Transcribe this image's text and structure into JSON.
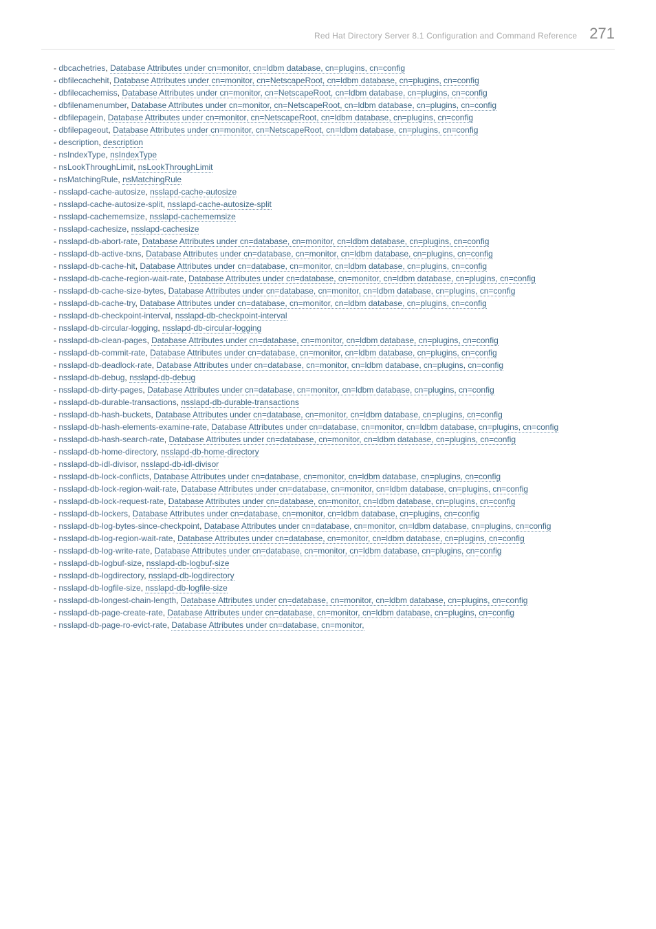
{
  "header": {
    "title": "Red Hat Directory Server 8.1 Configuration and Command Reference",
    "page_number": "271"
  },
  "items": [
    {
      "label": "dbcachetries",
      "link": "Database Attributes under cn=monitor, cn=ldbm database, cn=plugins, cn=config"
    },
    {
      "label": "dbfilecachehit",
      "link": "Database Attributes under cn=monitor, cn=NetscapeRoot, cn=ldbm database, cn=plugins, cn=config"
    },
    {
      "label": "dbfilecachemiss",
      "link": "Database Attributes under cn=monitor, cn=NetscapeRoot, cn=ldbm database, cn=plugins, cn=config"
    },
    {
      "label": "dbfilenamenumber",
      "link": "Database Attributes under cn=monitor, cn=NetscapeRoot, cn=ldbm database, cn=plugins, cn=config"
    },
    {
      "label": "dbfilepagein",
      "link": "Database Attributes under cn=monitor, cn=NetscapeRoot, cn=ldbm database, cn=plugins, cn=config"
    },
    {
      "label": "dbfilepageout",
      "link": "Database Attributes under cn=monitor, cn=NetscapeRoot, cn=ldbm database, cn=plugins, cn=config"
    },
    {
      "label": "description",
      "link": "description"
    },
    {
      "label": "nsIndexType",
      "link": "nsIndexType"
    },
    {
      "label": "nsLookThroughLimit",
      "link": "nsLookThroughLimit"
    },
    {
      "label": "nsMatchingRule",
      "link": "nsMatchingRule"
    },
    {
      "label": "nsslapd-cache-autosize",
      "link": "nsslapd-cache-autosize"
    },
    {
      "label": "nsslapd-cache-autosize-split",
      "link": "nsslapd-cache-autosize-split"
    },
    {
      "label": "nsslapd-cachememsize",
      "link": "nsslapd-cachememsize"
    },
    {
      "label": "nsslapd-cachesize",
      "link": "nsslapd-cachesize"
    },
    {
      "label": "nsslapd-db-abort-rate",
      "link": "Database Attributes under cn=database, cn=monitor, cn=ldbm database, cn=plugins, cn=config"
    },
    {
      "label": "nsslapd-db-active-txns",
      "link": "Database Attributes under cn=database, cn=monitor, cn=ldbm database, cn=plugins, cn=config"
    },
    {
      "label": "nsslapd-db-cache-hit",
      "link": "Database Attributes under cn=database, cn=monitor, cn=ldbm database, cn=plugins, cn=config"
    },
    {
      "label": "nsslapd-db-cache-region-wait-rate",
      "link": "Database Attributes under cn=database, cn=monitor, cn=ldbm database, cn=plugins, cn=config"
    },
    {
      "label": "nsslapd-db-cache-size-bytes",
      "link": "Database Attributes under cn=database, cn=monitor, cn=ldbm database, cn=plugins, cn=config"
    },
    {
      "label": "nsslapd-db-cache-try",
      "link": "Database Attributes under cn=database, cn=monitor, cn=ldbm database, cn=plugins, cn=config"
    },
    {
      "label": "nsslapd-db-checkpoint-interval",
      "link": "nsslapd-db-checkpoint-interval"
    },
    {
      "label": "nsslapd-db-circular-logging",
      "link": "nsslapd-db-circular-logging"
    },
    {
      "label": "nsslapd-db-clean-pages",
      "link": "Database Attributes under cn=database, cn=monitor, cn=ldbm database, cn=plugins, cn=config"
    },
    {
      "label": "nsslapd-db-commit-rate",
      "link": "Database Attributes under cn=database, cn=monitor, cn=ldbm database, cn=plugins, cn=config"
    },
    {
      "label": "nsslapd-db-deadlock-rate",
      "link": "Database Attributes under cn=database, cn=monitor, cn=ldbm database, cn=plugins, cn=config"
    },
    {
      "label": "nsslapd-db-debug",
      "link": "nsslapd-db-debug"
    },
    {
      "label": "nsslapd-db-dirty-pages",
      "link": "Database Attributes under cn=database, cn=monitor, cn=ldbm database, cn=plugins, cn=config"
    },
    {
      "label": "nsslapd-db-durable-transactions",
      "link": "nsslapd-db-durable-transactions"
    },
    {
      "label": "nsslapd-db-hash-buckets",
      "link": "Database Attributes under cn=database, cn=monitor, cn=ldbm database, cn=plugins, cn=config"
    },
    {
      "label": "nsslapd-db-hash-elements-examine-rate",
      "link": "Database Attributes under cn=database, cn=monitor, cn=ldbm database, cn=plugins, cn=config"
    },
    {
      "label": "nsslapd-db-hash-search-rate",
      "link": "Database Attributes under cn=database, cn=monitor, cn=ldbm database, cn=plugins, cn=config"
    },
    {
      "label": "nsslapd-db-home-directory",
      "link": "nsslapd-db-home-directory"
    },
    {
      "label": "nsslapd-db-idl-divisor",
      "link": "nsslapd-db-idl-divisor"
    },
    {
      "label": "nsslapd-db-lock-conflicts",
      "link": "Database Attributes under cn=database, cn=monitor, cn=ldbm database, cn=plugins, cn=config"
    },
    {
      "label": "nsslapd-db-lock-region-wait-rate",
      "link": "Database Attributes under cn=database, cn=monitor, cn=ldbm database, cn=plugins, cn=config"
    },
    {
      "label": "nsslapd-db-lock-request-rate",
      "link": "Database Attributes under cn=database, cn=monitor, cn=ldbm database, cn=plugins, cn=config"
    },
    {
      "label": "nsslapd-db-lockers",
      "link": "Database Attributes under cn=database, cn=monitor, cn=ldbm database, cn=plugins, cn=config"
    },
    {
      "label": "nsslapd-db-log-bytes-since-checkpoint",
      "link": "Database Attributes under cn=database, cn=monitor, cn=ldbm database, cn=plugins, cn=config"
    },
    {
      "label": "nsslapd-db-log-region-wait-rate",
      "link": "Database Attributes under cn=database, cn=monitor, cn=ldbm database, cn=plugins, cn=config"
    },
    {
      "label": "nsslapd-db-log-write-rate",
      "link": "Database Attributes under cn=database, cn=monitor, cn=ldbm database, cn=plugins, cn=config"
    },
    {
      "label": "nsslapd-db-logbuf-size",
      "link": "nsslapd-db-logbuf-size"
    },
    {
      "label": "nsslapd-db-logdirectory",
      "link": "nsslapd-db-logdirectory"
    },
    {
      "label": "nsslapd-db-logfile-size",
      "link": "nsslapd-db-logfile-size"
    },
    {
      "label": "nsslapd-db-longest-chain-length",
      "link": "Database Attributes under cn=database, cn=monitor, cn=ldbm database, cn=plugins, cn=config"
    },
    {
      "label": "nsslapd-db-page-create-rate",
      "link": "Database Attributes under cn=database, cn=monitor, cn=ldbm database, cn=plugins, cn=config"
    },
    {
      "label": "nsslapd-db-page-ro-evict-rate",
      "link": "Database Attributes under cn=database, cn=monitor,"
    }
  ]
}
